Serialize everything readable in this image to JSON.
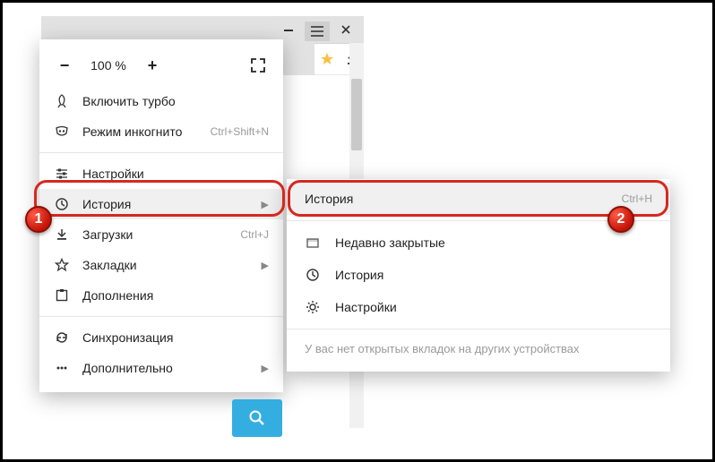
{
  "window": {
    "zoom": "100 %"
  },
  "menu": {
    "turbo": "Включить турбо",
    "incognito": "Режим инкогнито",
    "incognito_hint": "Ctrl+Shift+N",
    "settings": "Настройки",
    "history": "История",
    "downloads": "Загрузки",
    "downloads_hint": "Ctrl+J",
    "bookmarks": "Закладки",
    "addons": "Дополнения",
    "sync": "Синхронизация",
    "more": "Дополнительно"
  },
  "submenu": {
    "history": "История",
    "history_hint": "Ctrl+H",
    "recently_closed": "Недавно закрытые",
    "history2": "История",
    "settings": "Настройки",
    "no_tabs": "У вас нет открытых вкладок на других устройствах"
  },
  "annot": {
    "one": "1",
    "two": "2"
  }
}
